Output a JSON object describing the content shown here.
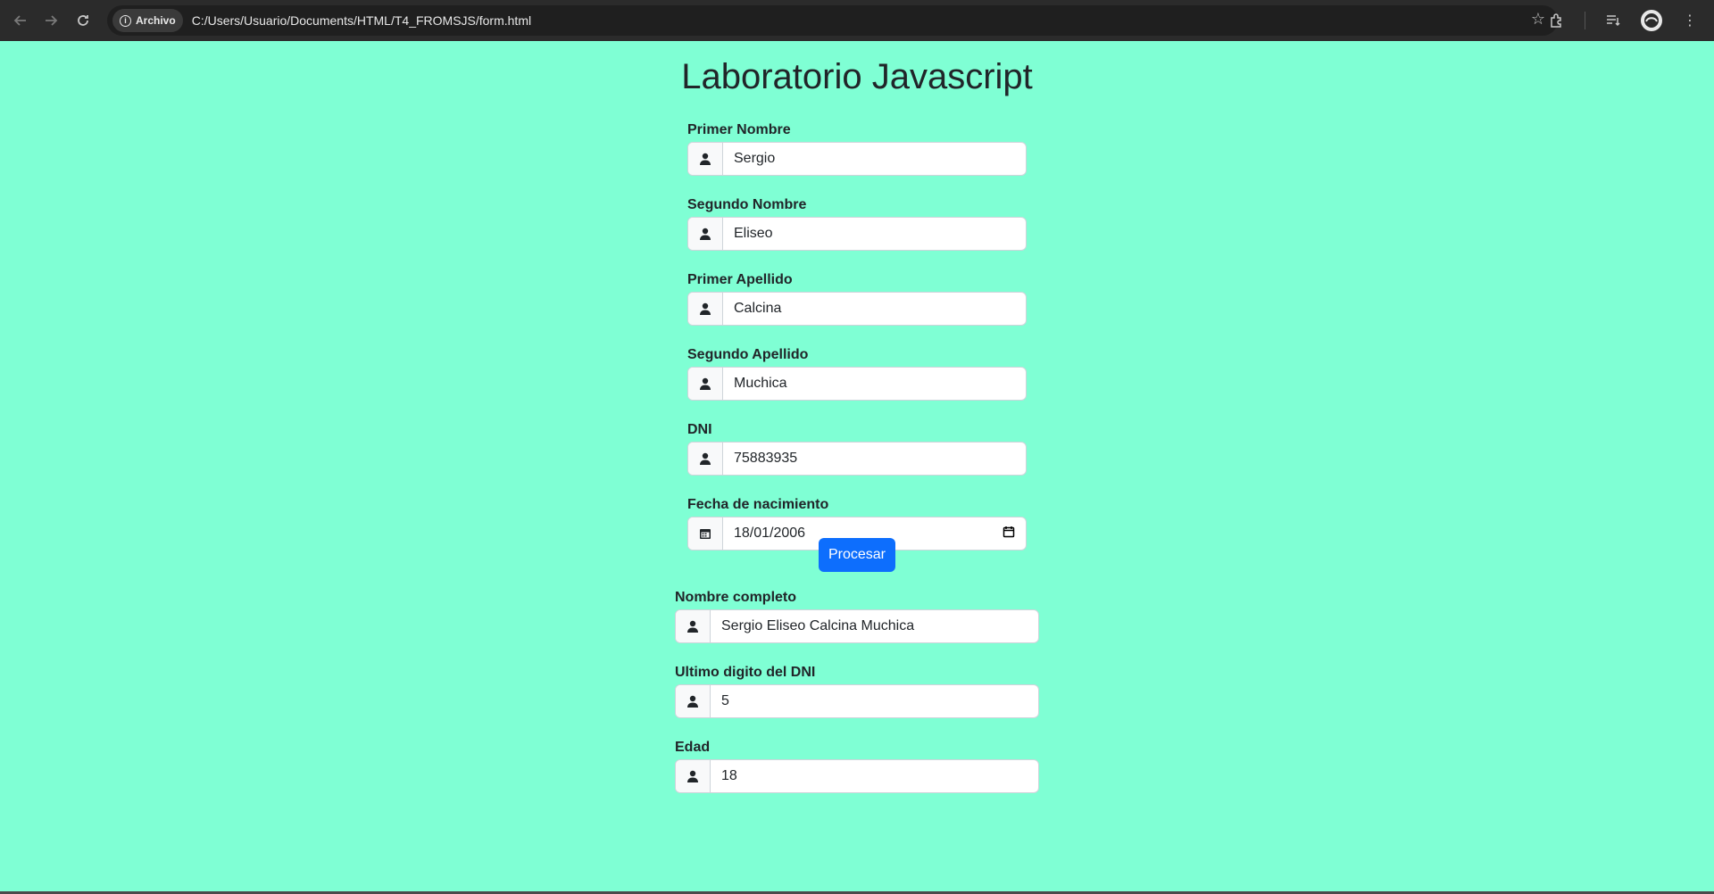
{
  "browser": {
    "chip_label": "Archivo",
    "url": "C:/Users/Usuario/Documents/HTML/T4_FROMSJS/form.html"
  },
  "page": {
    "title": "Laboratorio Javascript"
  },
  "form": {
    "fields": [
      {
        "label": "Primer Nombre",
        "value": "Sergio",
        "icon": "person-icon"
      },
      {
        "label": "Segundo Nombre",
        "value": "Eliseo",
        "icon": "person-icon"
      },
      {
        "label": "Primer Apellido",
        "value": "Calcina",
        "icon": "person-icon"
      },
      {
        "label": "Segundo Apellido",
        "value": "Muchica",
        "icon": "person-icon"
      },
      {
        "label": "DNI",
        "value": "75883935",
        "icon": "person-icon"
      },
      {
        "label": "Fecha de nacimiento",
        "value": "18/01/2006",
        "icon": "calendar-icon"
      }
    ],
    "submit_label": "Procesar"
  },
  "results": {
    "fields": [
      {
        "label": "Nombre completo",
        "value": "Sergio Eliseo Calcina Muchica",
        "icon": "person-icon"
      },
      {
        "label": "Ultimo digito del DNI",
        "value": "5",
        "icon": "person-icon"
      },
      {
        "label": "Edad",
        "value": "18",
        "icon": "person-icon"
      }
    ]
  },
  "colors": {
    "background": "#7fffd4",
    "button": "#0d6efd"
  }
}
